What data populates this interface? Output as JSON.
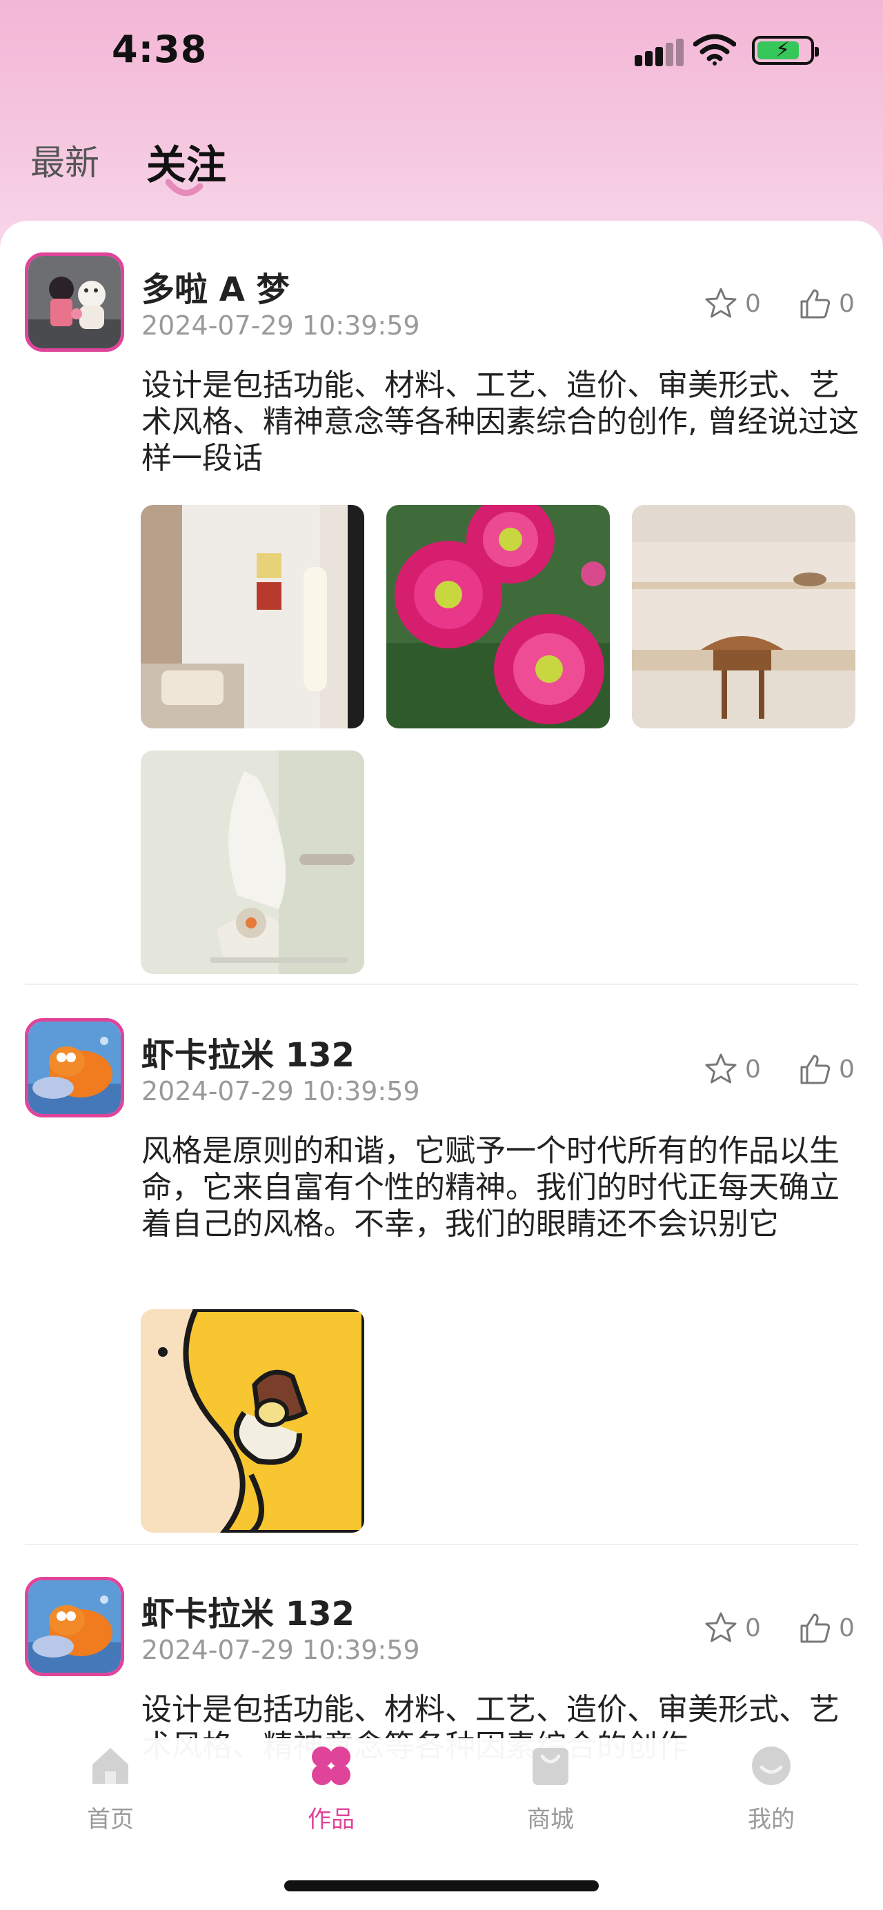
{
  "status_bar": {
    "time": "4:38"
  },
  "tabs": [
    {
      "label": "最新",
      "active": false
    },
    {
      "label": "关注",
      "active": true
    }
  ],
  "posts": [
    {
      "username": "多啦 A 梦",
      "date": "2024-07-29 10:39:59",
      "favorites": "0",
      "likes": "0",
      "text": "设计是包括功能、材料、工艺、造价、审美形式、艺术风格、精神意念等各种因素综合的创作, 曾经说过这样一段话",
      "image_count": 4
    },
    {
      "username": "虾卡拉米 132",
      "date": "2024-07-29 10:39:59",
      "favorites": "0",
      "likes": "0",
      "text": "风格是原则的和谐，它赋予一个时代所有的作品以生命，它来自富有个性的精神。我们的时代正每天确立着自己的风格。不幸，我们的眼睛还不会识别它",
      "image_count": 1
    },
    {
      "username": "虾卡拉米 132",
      "date": "2024-07-29 10:39:59",
      "favorites": "0",
      "likes": "0",
      "text": "设计是包括功能、材料、工艺、造价、审美形式、艺术风格、精神意念等各种因素综合的创作"
    }
  ],
  "bottom_nav": [
    {
      "label": "首页",
      "icon": "home-icon",
      "active": false
    },
    {
      "label": "作品",
      "icon": "clover-icon",
      "active": true
    },
    {
      "label": "商城",
      "icon": "shopping-bag-icon",
      "active": false
    },
    {
      "label": "我的",
      "icon": "smile-face-icon",
      "active": false
    }
  ],
  "colors": {
    "accent": "#e0449a",
    "header_pink": "#f3b6d6",
    "muted": "#9a9a9a"
  }
}
